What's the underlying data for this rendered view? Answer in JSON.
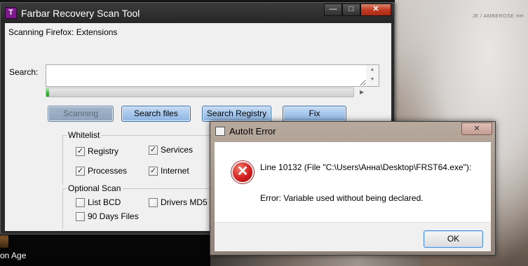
{
  "desktop": {
    "bottom_label": "on Age",
    "corner_text": "JE / AMBEROSE HH"
  },
  "main_window": {
    "title": "Farbar Recovery Scan Tool",
    "app_icon_letter": "T",
    "status_text": "Scanning Firefox: Extensions",
    "search": {
      "label": "Search:",
      "value": "",
      "placeholder": ""
    },
    "progress": 0.01,
    "buttons": {
      "scanning": "Scanning",
      "search_files": "Search files",
      "search_registry": "Search Registry",
      "fix": "Fix"
    },
    "whitelist": {
      "label": "Whitelist",
      "items": [
        {
          "label": "Registry",
          "checked": true
        },
        {
          "label": "Services",
          "checked": true
        },
        {
          "label": "Processes",
          "checked": true
        },
        {
          "label": "Internet",
          "checked": true
        }
      ]
    },
    "optional_scan": {
      "label": "Optional Scan",
      "items": [
        {
          "label": "List BCD",
          "checked": false
        },
        {
          "label": "Drivers MD5",
          "checked": false
        },
        {
          "label": "90 Days Files",
          "checked": false
        }
      ]
    }
  },
  "error_dialog": {
    "title": "AutoIt Error",
    "line1": "Line 10132  (File \"C:\\Users\\Анна\\Desktop\\FRST64.exe\"):",
    "line2": "Error: Variable used without being declared.",
    "ok_label": "OK"
  },
  "colors": {
    "button_blue": "#a7c7ec",
    "error_red": "#d42020",
    "progress_green": "#3cc23c"
  },
  "icons": {
    "app": "frst-app-icon",
    "error": "error-x-icon",
    "dialog": "window-icon"
  }
}
